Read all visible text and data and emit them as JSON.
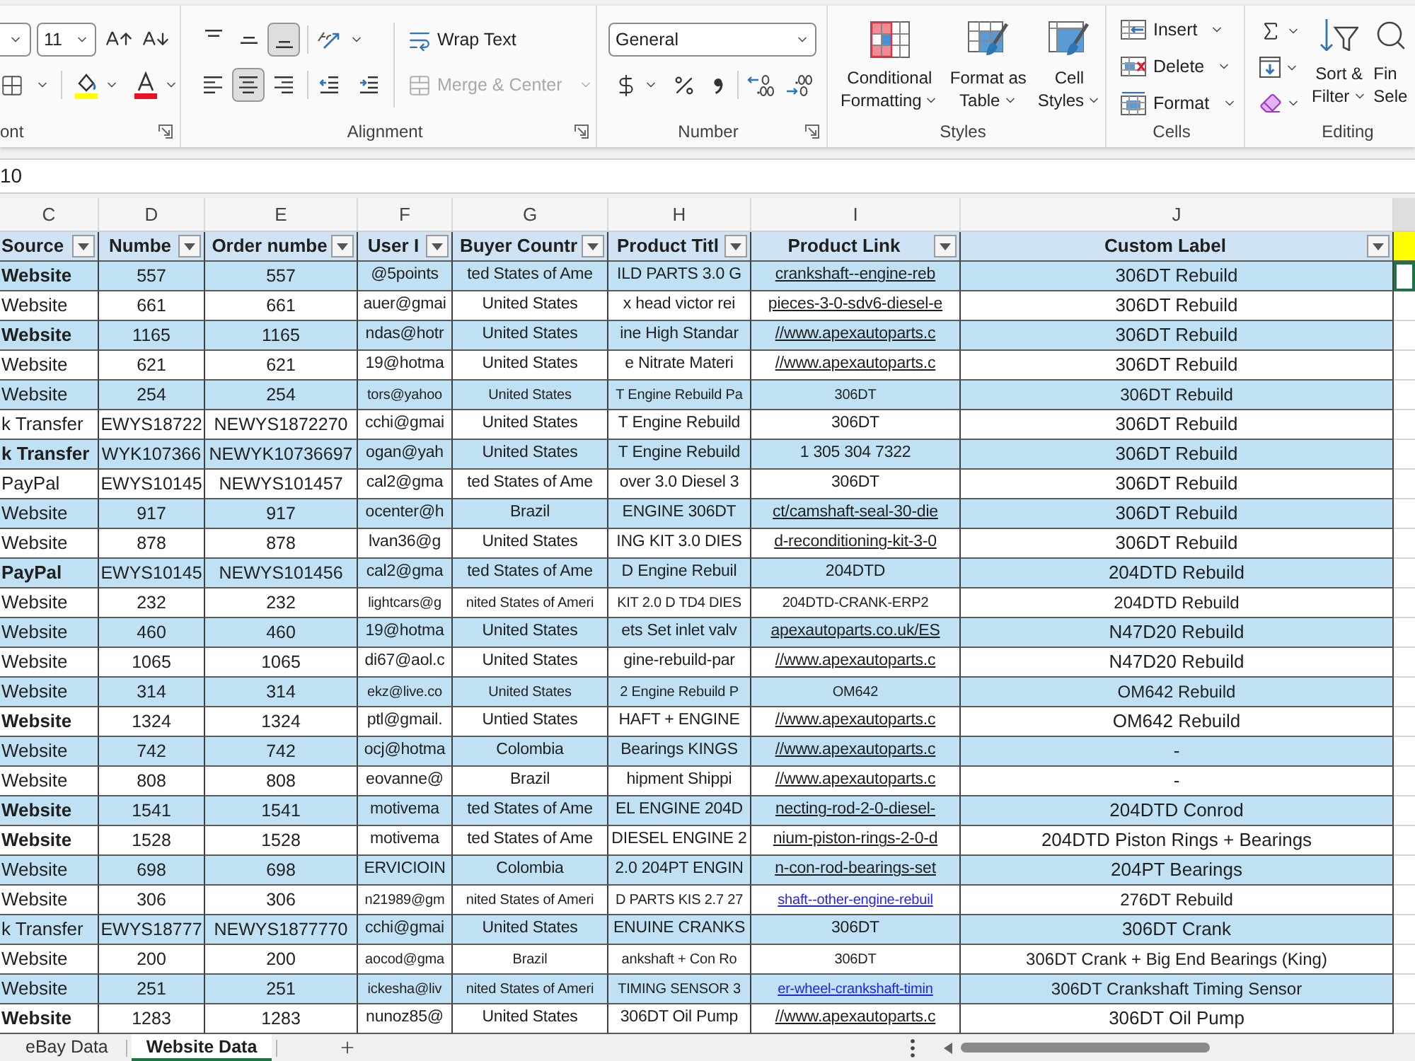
{
  "ribbon": {
    "font": {
      "label": "ont",
      "size": "11"
    },
    "alignment": {
      "label": "Alignment",
      "vertical": [
        {
          "kind": "top",
          "selected": false
        },
        {
          "kind": "middle",
          "selected": false
        },
        {
          "kind": "bottom",
          "selected": true
        }
      ],
      "horizontal": [
        {
          "kind": "left",
          "selected": false
        },
        {
          "kind": "center",
          "selected": true
        },
        {
          "kind": "right",
          "selected": false
        }
      ],
      "wrap_text": "Wrap Text",
      "merge_center": {
        "label": "Merge & Center",
        "disabled": true
      }
    },
    "number": {
      "label": "Number",
      "format": "General"
    },
    "styles": {
      "label": "Styles",
      "buttons": [
        {
          "kind": "conditional",
          "lines": [
            "Conditional",
            "Formatting"
          ]
        },
        {
          "kind": "table",
          "lines": [
            "Format as",
            "Table"
          ]
        },
        {
          "kind": "cell",
          "lines": [
            "Cell",
            "Styles"
          ]
        }
      ]
    },
    "cells": {
      "label": "Cells",
      "buttons": [
        {
          "kind": "insert",
          "label": "Insert"
        },
        {
          "kind": "delete",
          "label": "Delete"
        },
        {
          "kind": "format",
          "label": "Format"
        }
      ]
    },
    "editing": {
      "label": "Editing",
      "buttons": [
        {
          "kind": "sort",
          "lines": [
            "Sort &",
            "Filter"
          ]
        },
        {
          "kind": "find",
          "lines": [
            "Fin",
            "Sele"
          ]
        }
      ]
    }
  },
  "formula_bar": {
    "value": "10"
  },
  "sheet": {
    "column_letters": [
      "C",
      "D",
      "E",
      "F",
      "G",
      "H",
      "I",
      "J"
    ],
    "headers": [
      "Source",
      "Numbe",
      "Order numbe",
      "User I",
      "Buyer Countr",
      "Product Titl",
      "Product Link",
      "Custom Label"
    ],
    "rows": [
      {
        "cells": [
          "Website",
          "557",
          "557",
          "@5points",
          "ted States of Ame",
          "ILD PARTS 3.0 G",
          "crankshaft--engine-reb",
          "306DT Rebuild"
        ],
        "bold": true,
        "small": false,
        "link": true,
        "color": "#1f1f1f",
        "selected": true
      },
      {
        "cells": [
          "Website",
          "661",
          "661",
          "auer@gmai",
          "United States",
          "x head victor rei",
          "pieces-3-0-sdv6-diesel-e",
          "306DT Rebuild"
        ],
        "bold": false,
        "small": false,
        "link": true,
        "color": "#1f1f1f",
        "selected": false
      },
      {
        "cells": [
          "Website",
          "1165",
          "1165",
          "ndas@hotr",
          "United States",
          "ine High Standar",
          "//www.apexautoparts.c",
          "306DT Rebuild"
        ],
        "bold": true,
        "small": false,
        "link": true,
        "color": "#1f1f1f",
        "selected": false
      },
      {
        "cells": [
          "Website",
          "621",
          "621",
          "19@hotma",
          "United States",
          "e Nitrate Materi",
          "//www.apexautoparts.c",
          "306DT Rebuild"
        ],
        "bold": false,
        "small": false,
        "link": true,
        "color": "#1f1f1f",
        "selected": false
      },
      {
        "cells": [
          "Website",
          "254",
          "254",
          "tors@yahoo",
          "United States",
          "T Engine Rebuild Pa",
          "306DT",
          "306DT Rebuild"
        ],
        "bold": false,
        "small": true,
        "link": false,
        "color": "#1f1f1f",
        "selected": false
      },
      {
        "cells": [
          "k Transfer",
          "EWYS18722",
          "NEWYS1872270",
          "cchi@gmai",
          "United States",
          "T Engine Rebuild",
          "306DT",
          "306DT Rebuild"
        ],
        "bold": false,
        "small": false,
        "link": false,
        "color": "#1f1f1f",
        "selected": false
      },
      {
        "cells": [
          "k Transfer",
          "WYK107366",
          "NEWYK10736697",
          "ogan@yah",
          "United States",
          "T Engine Rebuild",
          "1 305 304 7322",
          "306DT Rebuild"
        ],
        "bold": true,
        "small": false,
        "link": false,
        "color": "#1f1f1f",
        "selected": false
      },
      {
        "cells": [
          "PayPal",
          "EWYS10145",
          "NEWYS101457",
          "cal2@gma",
          "ted States of Ame",
          "over 3.0 Diesel 3",
          "306DT",
          "306DT Rebuild"
        ],
        "bold": false,
        "small": false,
        "link": false,
        "color": "#1f1f1f",
        "selected": false
      },
      {
        "cells": [
          "Website",
          "917",
          "917",
          "ocenter@h",
          "Brazil",
          "ENGINE 306DT",
          "ct/camshaft-seal-30-die",
          "306DT Rebuild"
        ],
        "bold": false,
        "small": false,
        "link": true,
        "color": "#1f1f1f",
        "selected": false
      },
      {
        "cells": [
          "Website",
          "878",
          "878",
          "lvan36@g",
          "United States",
          "ING KIT 3.0 DIES",
          "d-reconditioning-kit-3-0",
          "306DT Rebuild"
        ],
        "bold": false,
        "small": false,
        "link": true,
        "color": "#1f1f1f",
        "selected": false
      },
      {
        "cells": [
          "PayPal",
          "EWYS10145",
          "NEWYS101456",
          "cal2@gma",
          "ted States of Ame",
          "D Engine Rebuil",
          "204DTD",
          "204DTD Rebuild"
        ],
        "bold": true,
        "small": false,
        "link": false,
        "color": "#1f1f1f",
        "selected": false
      },
      {
        "cells": [
          "Website",
          "232",
          "232",
          "lightcars@g",
          "nited States of Ameri",
          "KIT 2.0 D TD4 DIES",
          "204DTD-CRANK-ERP2",
          "204DTD Rebuild"
        ],
        "bold": false,
        "small": true,
        "link": false,
        "color": "#1f1f1f",
        "selected": false
      },
      {
        "cells": [
          "Website",
          "460",
          "460",
          "19@hotma",
          "United States",
          "ets Set inlet valv",
          "apexautoparts.co.uk/ES",
          "N47D20 Rebuild"
        ],
        "bold": false,
        "small": false,
        "link": true,
        "color": "#1f1f1f",
        "selected": false
      },
      {
        "cells": [
          "Website",
          "1065",
          "1065",
          "di67@aol.c",
          "United States",
          "gine-rebuild-par",
          "//www.apexautoparts.c",
          "N47D20 Rebuild"
        ],
        "bold": false,
        "small": false,
        "link": true,
        "color": "#1f1f1f",
        "selected": false
      },
      {
        "cells": [
          "Website",
          "314",
          "314",
          "ekz@live.co",
          "United States",
          "2 Engine Rebuild P",
          "OM642",
          "OM642 Rebuild"
        ],
        "bold": false,
        "small": true,
        "link": false,
        "color": "#1f1f1f",
        "selected": false
      },
      {
        "cells": [
          "Website",
          "1324",
          "1324",
          "ptl@gmail.",
          "Untied States",
          "HAFT + ENGINE",
          "//www.apexautoparts.c",
          "OM642 Rebuild"
        ],
        "bold": true,
        "small": false,
        "link": true,
        "color": "#1f1f1f",
        "selected": false
      },
      {
        "cells": [
          "Website",
          "742",
          "742",
          "ocj@hotma",
          "Colombia",
          "Bearings KINGS",
          "//www.apexautoparts.c",
          "-"
        ],
        "bold": false,
        "small": false,
        "link": true,
        "color": "#1f1f1f",
        "selected": false
      },
      {
        "cells": [
          "Website",
          "808",
          "808",
          "eovanne@",
          "Brazil",
          "hipment Shippi",
          "//www.apexautoparts.c",
          "-"
        ],
        "bold": false,
        "small": false,
        "link": true,
        "color": "#1f1f1f",
        "selected": false
      },
      {
        "cells": [
          "Website",
          "1541",
          "1541",
          "motivema",
          "ted States of Ame",
          "EL ENGINE 204D",
          "necting-rod-2-0-diesel-",
          "204DTD Conrod"
        ],
        "bold": true,
        "small": false,
        "link": true,
        "color": "#1f1f1f",
        "selected": false
      },
      {
        "cells": [
          "Website",
          "1528",
          "1528",
          "motivema",
          "ted States of Ame",
          "DIESEL ENGINE 2",
          "nium-piston-rings-2-0-d",
          "204DTD Piston Rings + Bearings"
        ],
        "bold": true,
        "small": false,
        "link": true,
        "color": "#1f1f1f",
        "selected": false
      },
      {
        "cells": [
          "Website",
          "698",
          "698",
          "ERVICIOIN",
          "Colombia",
          "2.0 204PT ENGIN",
          "n-con-rod-bearings-set",
          "204PT Bearings"
        ],
        "bold": false,
        "small": false,
        "link": true,
        "color": "#1f1f1f",
        "selected": false
      },
      {
        "cells": [
          "Website",
          "306",
          "306",
          "n21989@gm",
          "nited States of Ameri",
          "D PARTS KIS 2.7 27",
          "shaft--other-engine-rebuil",
          "276DT Rebuild"
        ],
        "bold": false,
        "small": true,
        "link": true,
        "color": "#2323e8",
        "selected": false
      },
      {
        "cells": [
          "k Transfer",
          "EWYS18777",
          "NEWYS1877770",
          "cchi@gmai",
          "United States",
          "ENUINE CRANKS",
          "306DT",
          "306DT Crank"
        ],
        "bold": false,
        "small": false,
        "link": false,
        "color": "#1f1f1f",
        "selected": false
      },
      {
        "cells": [
          "Website",
          "200",
          "200",
          "aocod@gma",
          "Brazil",
          "ankshaft + Con Ro",
          "306DT",
          "306DT Crank + Big End Bearings (King)"
        ],
        "bold": false,
        "small": true,
        "link": false,
        "color": "#1f1f1f",
        "selected": false
      },
      {
        "cells": [
          "Website",
          "251",
          "251",
          "ickesha@liv",
          "nited States of Ameri",
          "TIMING SENSOR 3",
          "er-wheel-crankshaft-timin",
          "306DT Crankshaft Timing Sensor"
        ],
        "bold": false,
        "small": true,
        "link": true,
        "color": "#2323e8",
        "selected": false
      },
      {
        "cells": [
          "Website",
          "1283",
          "1283",
          "nunoz85@",
          "United States",
          "306DT Oil Pump",
          "//www.apexautoparts.c",
          "306DT Oil Pump"
        ],
        "bold": true,
        "small": false,
        "link": true,
        "color": "#1f1f1f",
        "selected": false
      }
    ]
  },
  "sheet_tabs": [
    {
      "label": "eBay Data",
      "selected": false
    },
    {
      "label": "Website Data",
      "selected": true
    }
  ]
}
